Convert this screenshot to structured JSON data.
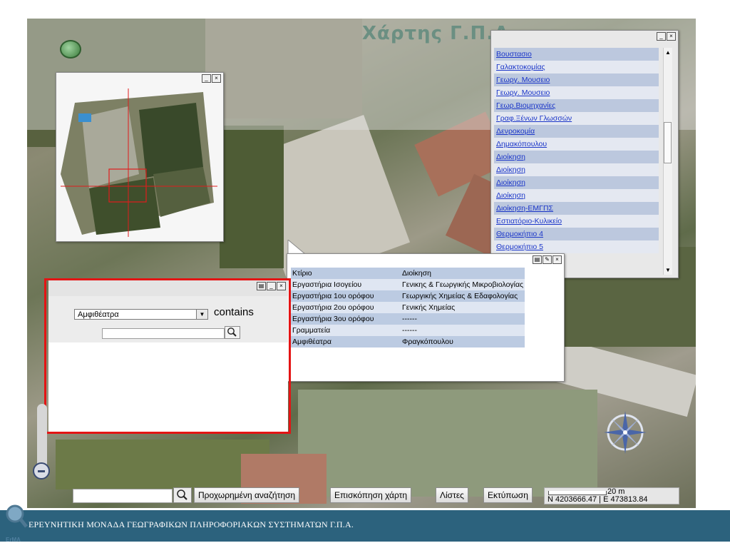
{
  "map": {
    "title": "Χάρτης Γ.Π.Α"
  },
  "list_window": {
    "items": [
      "Βουστασιο",
      "Γαλακτοκομίας",
      "Γεωργ. Μουσειο",
      "Γεωργ. Μουσειο",
      "Γεωρ.Βιομηχανίες",
      "Γραφ.Ξένων Γλωσσών",
      "Δενροκομία",
      "Δημακόπουλου",
      "Διοίκηση",
      "Διοίκηση",
      "Διοίκηση",
      "Διοίκηση",
      "Διοίκηση-ΕΜΓΠΣ",
      "Εστιατόριο-Κυλικείο",
      "Θερμοκήπιο 4",
      "Θερμοκήπιο 5"
    ]
  },
  "info_window": {
    "rows": [
      {
        "key": "Κτίριο",
        "value": "Διοίκηση"
      },
      {
        "key": "Εργαστήρια Ισογείου",
        "value": "Γενικης & Γεωργικής Μικροβιολογίας"
      },
      {
        "key": "Εργαστήρια 1ου ορόφου",
        "value": "Γεωργικής Χημείας & Εδαφολογίας"
      },
      {
        "key": "Εργαστήρια 2ου ορόφου",
        "value": "Γενικής Χημείας"
      },
      {
        "key": "Εργαστήρια 3ου ορόφου",
        "value": "------"
      },
      {
        "key": "Γραμματεία",
        "value": "------"
      },
      {
        "key": "Αμφιθέατρα",
        "value": "Φραγκόπουλου"
      }
    ]
  },
  "search_panel": {
    "selected_field": "Αμφιθέατρα",
    "operator": "contains",
    "query": ""
  },
  "toolbar": {
    "search_value": "",
    "advanced_search": "Προχωρημένη αναζήτηση",
    "map_overview": "Επισκόπηση χάρτη",
    "lists": "Λίστες",
    "print": "Εκτύπωση"
  },
  "scale": {
    "label": "20 m",
    "coordinates": "N 4203666.47 | E 473813.84"
  },
  "footer": {
    "text": "ΕΡΕΥΝΗΤΙΚΗ ΜΟΝΑΔΑ ΓΕΩΓΡΑΦΙΚΩΝ ΠΛΗΡΟΦΟΡΙΑΚΩΝ ΣΥΣΤΗΜΑΤΩΝ Γ.Π.Α.",
    "logo_text": "ErMA"
  },
  "colors": {
    "footer_bg": "#2c627d",
    "highlight_frame": "#e41414",
    "link": "#1a35c8",
    "row_dark": "#bcc8de",
    "row_light": "#e4e8f1"
  }
}
